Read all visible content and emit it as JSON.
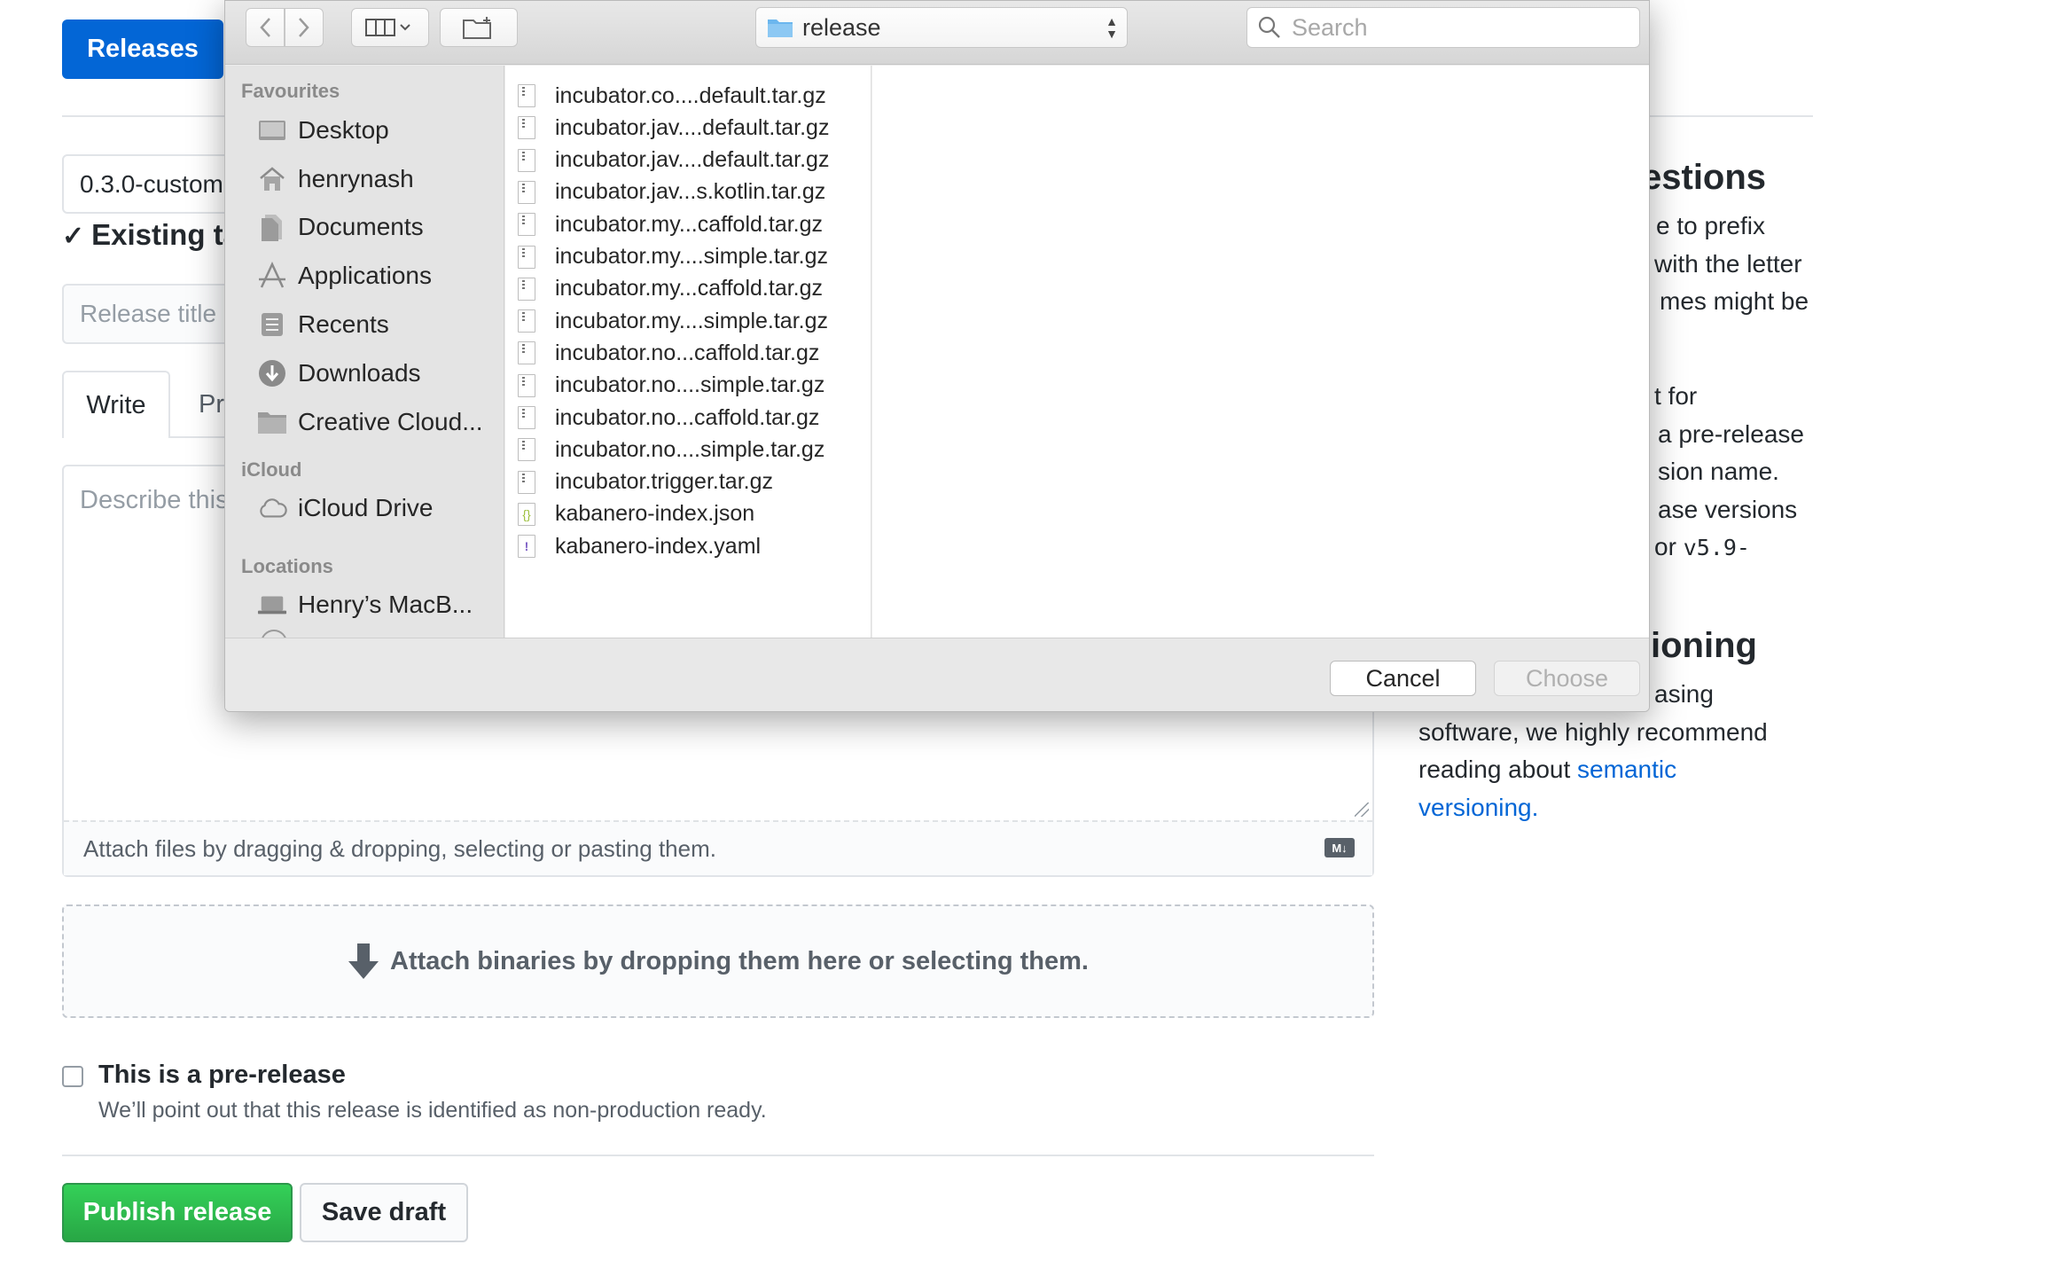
{
  "page": {
    "releases_button": "Releases",
    "tag_value": "0.3.0-custom",
    "existing_tag_label": "Existing ta",
    "release_title_placeholder": "Release title",
    "tabs": {
      "write": "Write",
      "preview": "Pr"
    },
    "editor_placeholder": "Describe this",
    "attach_hint": "Attach files by dragging & dropping, selecting or pasting them.",
    "markdown_badge": "M↓",
    "dropzone_text": "Attach binaries by dropping them here or selecting them.",
    "prerelease": {
      "title": "This is a pre-release",
      "description": "We’ll point out that this release is identified as non-production ready."
    },
    "publish_button": "Publish release",
    "save_draft_button": "Save draft"
  },
  "sidebar": {
    "heading1": "estions",
    "lines1": [
      "e to prefix",
      "with the letter",
      "mes might be"
    ],
    "lines2": [
      "t for",
      "a pre-release",
      "sion name.",
      "ase versions"
    ],
    "line2_last_prefix": "or ",
    "line2_last_code": "v5.9-",
    "heading2": "ioning",
    "lines3": [
      "asing",
      "software, we highly recommend"
    ],
    "reading_prefix": "reading about ",
    "link1": "semantic",
    "link2": "versioning."
  },
  "dialog": {
    "location": "release",
    "search_placeholder": "Search",
    "sections": {
      "favourites": "Favourites",
      "icloud": "iCloud",
      "locations": "Locations"
    },
    "favourites": [
      {
        "label": "Desktop",
        "icon": "desktop-icon"
      },
      {
        "label": "henrynash",
        "icon": "home-icon"
      },
      {
        "label": "Documents",
        "icon": "document-icon"
      },
      {
        "label": "Applications",
        "icon": "applications-icon"
      },
      {
        "label": "Recents",
        "icon": "recents-icon"
      },
      {
        "label": "Downloads",
        "icon": "downloads-icon"
      },
      {
        "label": "Creative Cloud...",
        "icon": "folder-icon"
      }
    ],
    "icloud_items": [
      {
        "label": "iCloud Drive",
        "icon": "cloud-icon"
      }
    ],
    "location_items": [
      {
        "label": "Henry’s MacB...",
        "icon": "laptop-icon"
      }
    ],
    "files": [
      "incubator.co....default.tar.gz",
      "incubator.jav....default.tar.gz",
      "incubator.jav....default.tar.gz",
      "incubator.jav...s.kotlin.tar.gz",
      "incubator.my...caffold.tar.gz",
      "incubator.my....simple.tar.gz",
      "incubator.my...caffold.tar.gz",
      "incubator.my....simple.tar.gz",
      "incubator.no...caffold.tar.gz",
      "incubator.no....simple.tar.gz",
      "incubator.no...caffold.tar.gz",
      "incubator.no....simple.tar.gz",
      "incubator.trigger.tar.gz",
      "kabanero-index.json",
      "kabanero-index.yaml"
    ],
    "file_types": [
      "archive",
      "archive",
      "archive",
      "archive",
      "archive",
      "archive",
      "archive",
      "archive",
      "archive",
      "archive",
      "archive",
      "archive",
      "archive",
      "json",
      "yaml"
    ],
    "cancel_button": "Cancel",
    "choose_button": "Choose"
  }
}
